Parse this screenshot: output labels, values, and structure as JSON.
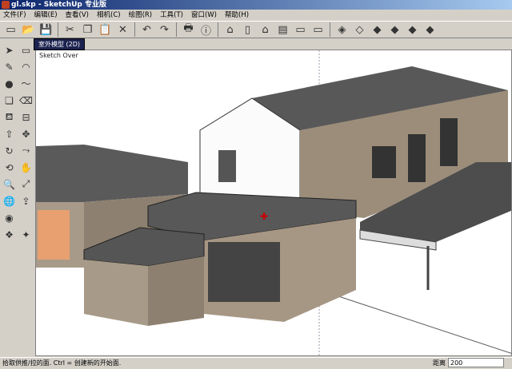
{
  "window": {
    "title": "gl.skp - SketchUp 专业版"
  },
  "menu": [
    "文件(F)",
    "编辑(E)",
    "查看(V)",
    "相机(C)",
    "绘图(R)",
    "工具(T)",
    "窗口(W)",
    "帮助(H)"
  ],
  "toolbar": [
    {
      "icon": "new-icon",
      "glyph": "▭"
    },
    {
      "icon": "open-icon",
      "glyph": "📂"
    },
    {
      "icon": "save-icon",
      "glyph": "💾"
    },
    "sep",
    {
      "icon": "cut-icon",
      "glyph": "✂"
    },
    {
      "icon": "copy-icon",
      "glyph": "❐"
    },
    {
      "icon": "paste-icon",
      "glyph": "📋"
    },
    {
      "icon": "delete-icon",
      "glyph": "✕"
    },
    "sep",
    {
      "icon": "undo-icon",
      "glyph": "↶"
    },
    {
      "icon": "redo-icon",
      "glyph": "↷"
    },
    "sep",
    {
      "icon": "print-icon",
      "glyph": "🖶"
    },
    {
      "icon": "model-info-icon",
      "glyph": "ⓘ"
    },
    "sep",
    {
      "icon": "iso-view-icon",
      "glyph": "⌂"
    },
    {
      "icon": "top-view-icon",
      "glyph": "▯"
    },
    {
      "icon": "front-view-icon",
      "glyph": "⌂"
    },
    {
      "icon": "right-view-icon",
      "glyph": "▤"
    },
    {
      "icon": "back-view-icon",
      "glyph": "▭"
    },
    {
      "icon": "left-view-icon",
      "glyph": "▭"
    },
    "sep",
    {
      "icon": "xray-icon",
      "glyph": "◈"
    },
    {
      "icon": "wireframe-icon",
      "glyph": "◇"
    },
    {
      "icon": "hidden-line-icon",
      "glyph": "◆"
    },
    {
      "icon": "shaded-icon",
      "glyph": "◆"
    },
    {
      "icon": "shaded-textures-icon",
      "glyph": "◆"
    },
    {
      "icon": "monochrome-icon",
      "glyph": "◆"
    }
  ],
  "tools": [
    {
      "icon": "select-icon",
      "glyph": "➤"
    },
    {
      "icon": "rectangle-icon",
      "glyph": "▭"
    },
    {
      "icon": "line-icon",
      "glyph": "✎"
    },
    {
      "icon": "arc-icon",
      "glyph": "◠"
    },
    {
      "icon": "circle-icon",
      "glyph": "●"
    },
    {
      "icon": "freehand-icon",
      "glyph": "〜"
    },
    {
      "icon": "make-component-icon",
      "glyph": "❏"
    },
    {
      "icon": "eraser-icon",
      "glyph": "⌫"
    },
    {
      "icon": "paint-bucket-icon",
      "glyph": "⛾"
    },
    {
      "icon": "tape-measure-icon",
      "glyph": "⊟"
    },
    {
      "icon": "push-pull-icon",
      "glyph": "⇧"
    },
    {
      "icon": "move-icon",
      "glyph": "✥"
    },
    {
      "icon": "rotate-icon",
      "glyph": "↻"
    },
    {
      "icon": "follow-me-icon",
      "glyph": "⤳"
    },
    {
      "icon": "orbit-icon",
      "glyph": "⟲"
    },
    {
      "icon": "pan-icon",
      "glyph": "✋"
    },
    {
      "icon": "zoom-icon",
      "glyph": "🔍"
    },
    {
      "icon": "zoom-extents-icon",
      "glyph": "⤢"
    },
    {
      "icon": "get-models-icon",
      "glyph": "🌐"
    },
    {
      "icon": "share-model-icon",
      "glyph": "⇪"
    },
    {
      "icon": "google-earth-icon",
      "glyph": "◉"
    },
    {
      "icon": "placeholder-icon",
      "glyph": ""
    },
    {
      "icon": "components-icon",
      "glyph": "❖"
    },
    {
      "icon": "materials-icon",
      "glyph": "✦"
    }
  ],
  "tooltip": "室外模型 (2D)",
  "scene_label": "Sketch Over",
  "status": {
    "text": "拾取供推/拉的面. Ctrl = 创建新的开始面.",
    "measure_label": "距离",
    "measure_value": "200"
  }
}
